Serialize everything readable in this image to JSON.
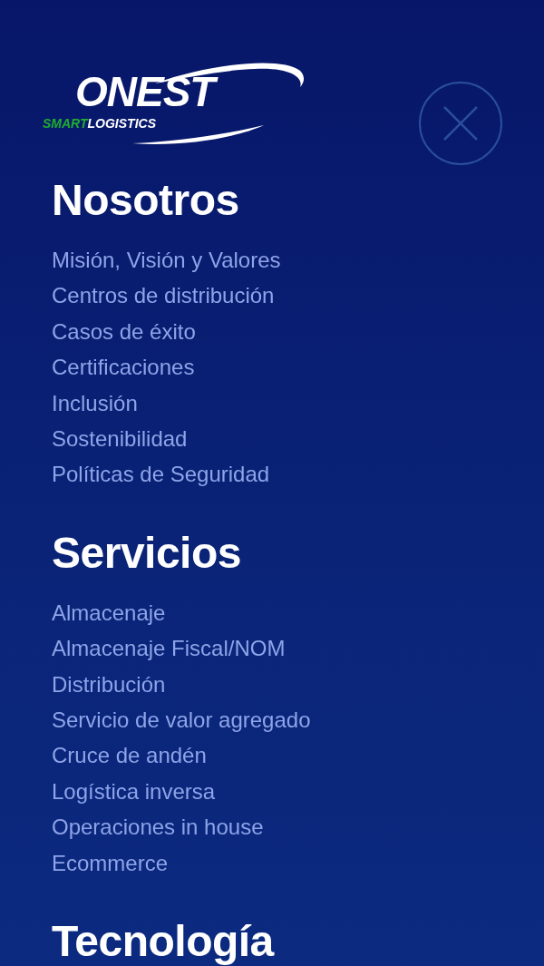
{
  "logo": {
    "wordmark": "ONEST",
    "tagline_accent": "SMART",
    "tagline": "LOGISTICS"
  },
  "sections": [
    {
      "title": "Nosotros",
      "links": [
        "Misión, Visión y Valores",
        "Centros de distribución",
        "Casos de éxito",
        "Certificaciones",
        "Inclusión",
        "Sostenibilidad",
        "Políticas de Seguridad"
      ]
    },
    {
      "title": "Servicios",
      "links": [
        "Almacenaje",
        "Almacenaje Fiscal/NOM",
        "Distribución",
        "Servicio de valor agregado",
        "Cruce de andén",
        "Logística inversa",
        "Operaciones in house",
        "Ecommerce"
      ]
    },
    {
      "title": "Tecnología"
    }
  ]
}
